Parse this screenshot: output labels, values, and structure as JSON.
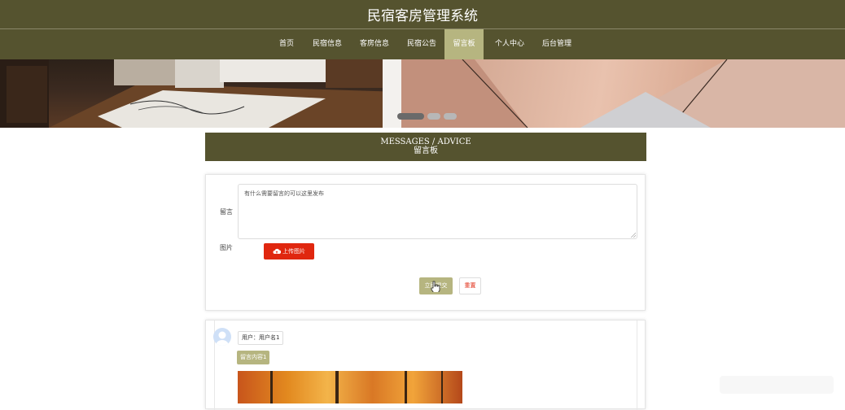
{
  "header": {
    "title": "民宿客房管理系统"
  },
  "nav": {
    "items": [
      "首页",
      "民宿信息",
      "客房信息",
      "民宿公告",
      "留言板",
      "个人中心",
      "后台管理"
    ],
    "active": "留言板"
  },
  "banner": {
    "slide_count": 3,
    "active_slide": 1
  },
  "section": {
    "title_en": "MESSAGES / ADVICE",
    "title_cn": "留言板"
  },
  "form": {
    "message_label": "留言",
    "message_value": "有什么需要留言的可以这里发布",
    "image_label": "图片",
    "upload_label": "上传图片",
    "submit_label": "立即提交",
    "reset_label": "重置"
  },
  "messages": [
    {
      "user": "用户：用户名1",
      "content": "留言内容1"
    }
  ],
  "colors": {
    "theme": "#55532f",
    "accent": "#b6b580",
    "danger": "#e0270f"
  }
}
